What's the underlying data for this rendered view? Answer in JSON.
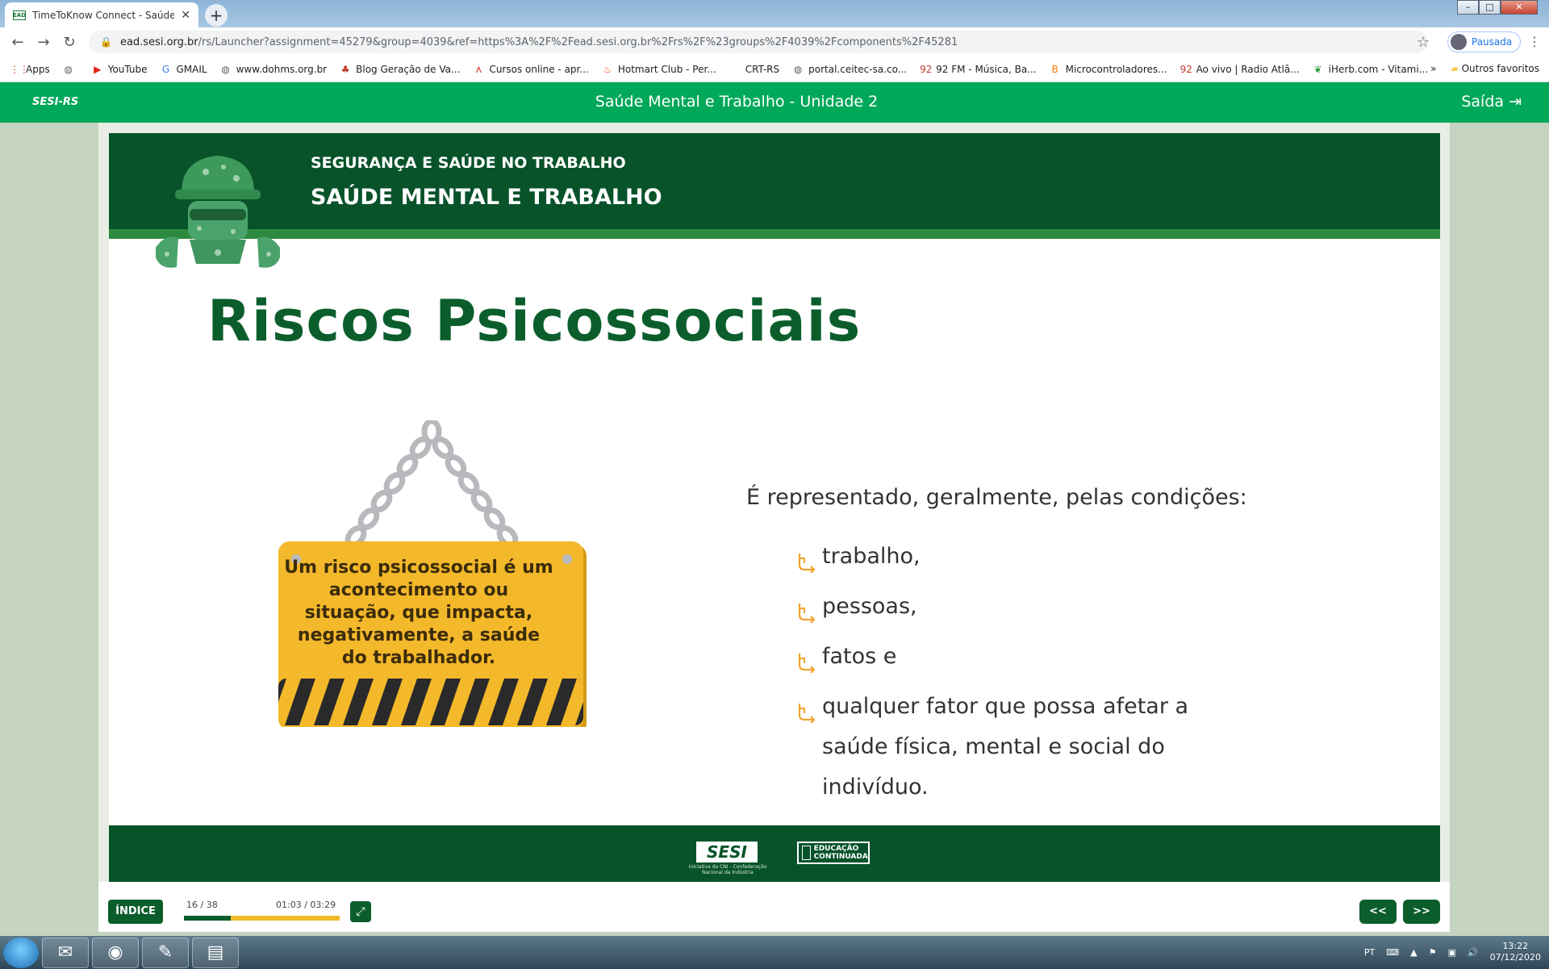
{
  "browser": {
    "tab_title": "TimeToKnow Connect - Saúde M",
    "tab_favicon": "EAD",
    "url_host": "ead.sesi.org.br",
    "url_path": "/rs/Launcher?assignment=45279&group=4039&ref=https%3A%2F%2Fead.sesi.org.br%2Frs%2F%23groups%2F4039%2Fcomponents%2F45281",
    "profile_label": "Pausada",
    "bookmarks": [
      {
        "label": "Apps",
        "icon": "apps-grid-icon"
      },
      {
        "label": "",
        "icon": "globe-icon"
      },
      {
        "label": "YouTube",
        "icon": "youtube-icon"
      },
      {
        "label": "GMAIL",
        "icon": "google-icon"
      },
      {
        "label": "www.dohms.org.br",
        "icon": "globe-icon"
      },
      {
        "label": "Blog Geração de Va...",
        "icon": "blog-icon"
      },
      {
        "label": "Cursos online - apr...",
        "icon": "cursos-icon"
      },
      {
        "label": "Hotmart Club - Per...",
        "icon": "hotmart-icon"
      },
      {
        "label": "CRT-RS",
        "icon": "blank-icon"
      },
      {
        "label": "portal.ceitec-sa.co...",
        "icon": "globe-icon"
      },
      {
        "label": "92 FM - Música, Ba...",
        "icon": "radio-icon"
      },
      {
        "label": "Microcontroladores...",
        "icon": "blogger-icon"
      },
      {
        "label": "Ao vivo | Radio Atlâ...",
        "icon": "radio-icon"
      },
      {
        "label": "iHerb.com - Vitami...",
        "icon": "leaf-icon"
      }
    ],
    "more_bookmarks": "»",
    "other_bookmarks": "Outros favoritos"
  },
  "app": {
    "brand": "SESI-RS",
    "course_title": "Saúde Mental e Trabalho - Unidade 2",
    "exit_label": "Saída"
  },
  "slide": {
    "header_sup": "SEGURANÇA E SAÚDE NO TRABALHO",
    "header_main": "SAÚDE MENTAL E TRABALHO",
    "title": "Riscos Psicossociais",
    "sign_text": "Um risco psicossocial é um acontecimento ou situação, que impacta, negativamente, a saúde do trabalhador.",
    "intro": "É representado, geralmente, pelas condições:",
    "bullets": [
      "trabalho,",
      "pessoas,",
      "fatos e",
      "qualquer fator que possa afetar a saúde física, mental e social do indivíduo."
    ],
    "footer_logo": "SESI",
    "footer_logo_sub": "Iniciativa da CNI - Confederação Nacional da Indústria",
    "footer_edu": "EDUCAÇÃO CONTINUADA"
  },
  "player": {
    "index_label": "ÍNDICE",
    "page_counter": "16 / 38",
    "time_counter": "01:03 / 03:29",
    "progress": 0.3,
    "prev_label": "<<",
    "next_label": ">>"
  },
  "taskbar": {
    "lang": "PT",
    "time": "13:22",
    "date": "07/12/2020"
  },
  "colors": {
    "app_green": "#00a85a",
    "dark_green": "#08532a",
    "sign_yellow": "#f2b82b",
    "bullet_orange": "#f2a32b"
  }
}
